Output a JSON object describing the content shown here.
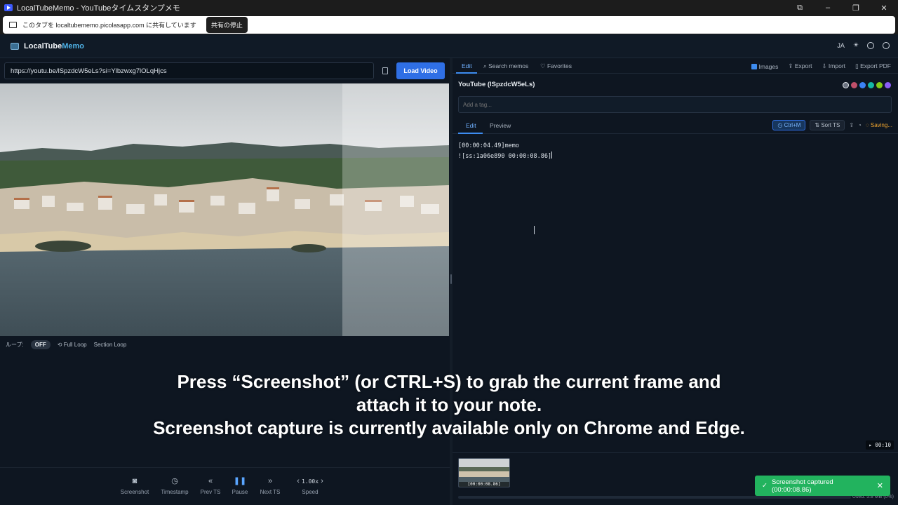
{
  "window": {
    "title": "LocalTubeMemo - YouTubeタイムスタンプメモ",
    "controls": [
      "minimize",
      "maximize",
      "close"
    ]
  },
  "share_bar": {
    "message": "このタブを localtubememo.picolasapp.com に共有しています",
    "stop_label": "共有の停止"
  },
  "app": {
    "name_main": "LocalTube",
    "name_accent": "Memo",
    "lang_label": "JA"
  },
  "player": {
    "url_value": "https://youtu.be/lSpzdcW5eLs?si=Ylbzwxg7lOLqHjcs",
    "load_label": "Load Video",
    "loop_label": "ループ:",
    "loop_state": "OFF",
    "full_loop_label": "Full Loop",
    "section_loop_label": "Section Loop"
  },
  "controls": [
    {
      "name": "screenshot",
      "label": "Screenshot",
      "icon": "camera-icon"
    },
    {
      "name": "timestamp",
      "label": "Timestamp",
      "icon": "clock-icon"
    },
    {
      "name": "prev-ts",
      "label": "Prev TS",
      "icon": "double-chevron-left-icon"
    },
    {
      "name": "pause",
      "label": "Pause",
      "icon": "pause-icon"
    },
    {
      "name": "next-ts",
      "label": "Next TS",
      "icon": "double-chevron-right-icon"
    }
  ],
  "speed": {
    "value": "1.00x",
    "label": "Speed"
  },
  "memo": {
    "tabs": [
      "Edit",
      "Search memos",
      "Favorites"
    ],
    "tools": {
      "images": "Images",
      "export": "Export",
      "import": "Import",
      "export_pdf": "Export PDF"
    },
    "doc_title": "YouTube (lSpzdcW5eLs)",
    "tag_placeholder": "Add a tag...",
    "subtabs": [
      "Edit",
      "Preview"
    ],
    "ctrl_m_label": "Ctrl+M",
    "sort_label": "Sort TS",
    "saving_label": "Saving...",
    "editor_lines": [
      "[00:00:04.49]memo",
      "![ss:1a06e890 00:00:08.86]"
    ],
    "time_badge": "▸ 00:10",
    "thumb_label": "[00:00:08.86]",
    "used_label": "Used: 5.8 MB (0%)",
    "tag_colors": [
      "#6b7280",
      "#c0506a",
      "#3b82f6",
      "#14b8a6",
      "#84cc16",
      "#8b5cf6"
    ]
  },
  "toast": {
    "message": "Screenshot captured (00:00:08.86)"
  },
  "caption": {
    "line1": "Press “Screenshot” (or CTRL+S) to grab the current frame and",
    "line2": "attach it to your note.",
    "line3": "Screenshot capture is currently available only on Chrome and Edge."
  }
}
